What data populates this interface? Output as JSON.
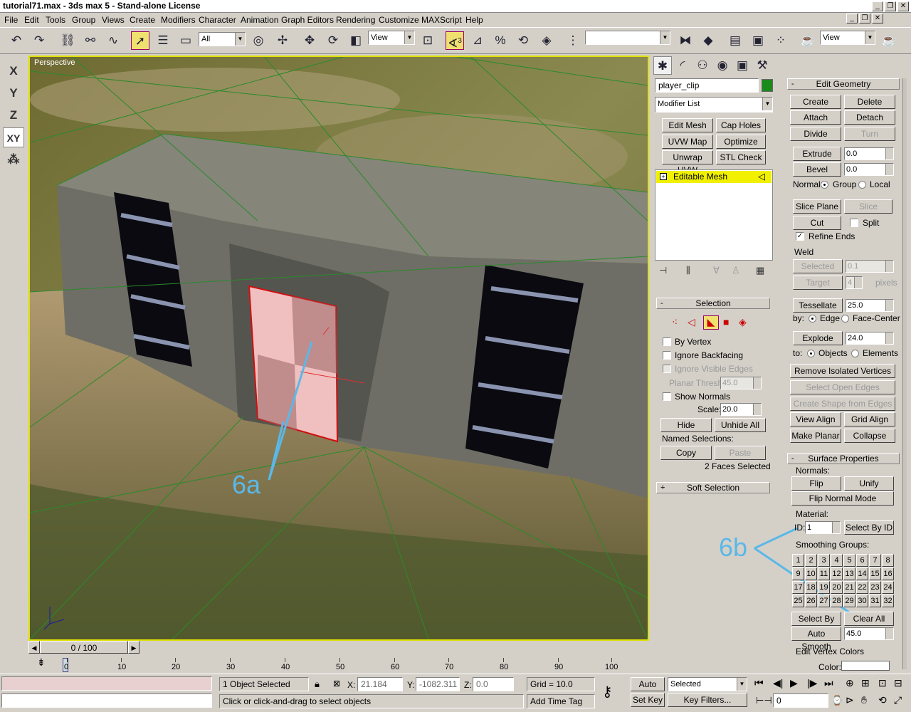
{
  "window": {
    "title": "tutorial71.max - 3ds max 5 - Stand-alone License",
    "min": "_",
    "restore": "❐",
    "close": "✕"
  },
  "menu": [
    "File",
    "Edit",
    "Tools",
    "Group",
    "Views",
    "Create",
    "Modifiers",
    "Character",
    "Animation",
    "Graph Editors",
    "Rendering",
    "Customize",
    "MAXScript",
    "Help"
  ],
  "toolbar": {
    "selection_filter": "All",
    "ref_coord": "View",
    "named_set": "",
    "view_dropdown": "View",
    "angle_snap_num": "3"
  },
  "axis_buttons": [
    "X",
    "Y",
    "Z",
    "XY"
  ],
  "viewport": {
    "label": "Perspective",
    "annotation_a": "6a",
    "annotation_b": "6b"
  },
  "cmdpanel": {
    "object_name": "player_clip",
    "object_color": "#1a8a1a",
    "modifier_list": "Modifier List",
    "mod_buttons": [
      "Edit Mesh",
      "Cap Holes",
      "UVW Map",
      "Optimize",
      "Unwrap UVW",
      "STL Check"
    ],
    "stack_item": "Editable Mesh",
    "selection": {
      "title": "Selection",
      "by_vertex": "By Vertex",
      "ignore_backfacing": "Ignore Backfacing",
      "ignore_visible_edges": "Ignore Visible Edges",
      "planar_thresh_label": "Planar Thresh:",
      "planar_thresh": "45.0",
      "show_normals": "Show Normals",
      "scale_label": "Scale:",
      "scale": "20.0",
      "hide": "Hide",
      "unhide_all": "Unhide All",
      "named_sel": "Named Selections:",
      "copy": "Copy",
      "paste": "Paste",
      "status": "2 Faces Selected"
    },
    "soft_selection": "Soft Selection"
  },
  "edit_geometry": {
    "title": "Edit Geometry",
    "create": "Create",
    "delete": "Delete",
    "attach": "Attach",
    "detach": "Detach",
    "divide": "Divide",
    "turn": "Turn",
    "extrude": "Extrude",
    "extrude_val": "0.0",
    "bevel": "Bevel",
    "bevel_val": "0.0",
    "normal_label": "Normal:",
    "group": "Group",
    "local": "Local",
    "slice_plane": "Slice Plane",
    "slice": "Slice",
    "cut": "Cut",
    "split": "Split",
    "refine_ends": "Refine Ends",
    "weld": "Weld",
    "selected": "Selected",
    "selected_val": "0.1",
    "target": "Target",
    "target_val": "4",
    "pixels": "pixels",
    "tessellate": "Tessellate",
    "tessellate_val": "25.0",
    "by": "by:",
    "edge": "Edge",
    "face_center": "Face-Center",
    "explode": "Explode",
    "explode_val": "24.0",
    "to": "to:",
    "objects": "Objects",
    "elements": "Elements",
    "remove_isolated": "Remove Isolated Vertices",
    "select_open_edges": "Select Open Edges",
    "create_shape": "Create Shape from Edges",
    "view_align": "View Align",
    "grid_align": "Grid Align",
    "make_planar": "Make Planar",
    "collapse": "Collapse"
  },
  "surface": {
    "title": "Surface Properties",
    "normals": "Normals:",
    "flip": "Flip",
    "unify": "Unify",
    "flip_normal_mode": "Flip Normal Mode",
    "material": "Material:",
    "id_label": "ID:",
    "id_val": "1",
    "select_by_id": "Select By ID",
    "smoothing_groups": "Smoothing Groups:",
    "sg": [
      "1",
      "2",
      "3",
      "4",
      "5",
      "6",
      "7",
      "8",
      "9",
      "10",
      "11",
      "12",
      "13",
      "14",
      "15",
      "16",
      "17",
      "18",
      "19",
      "20",
      "21",
      "22",
      "23",
      "24",
      "25",
      "26",
      "27",
      "28",
      "29",
      "30",
      "31",
      "32"
    ],
    "select_by_sg": "Select By SG",
    "clear_all": "Clear All",
    "auto_smooth": "Auto Smooth",
    "auto_smooth_val": "45.0",
    "edit_vertex_colors": "Edit Vertex Colors",
    "color": "Color:"
  },
  "timeline": {
    "frame": "0 / 100",
    "ticks": [
      "0",
      "10",
      "20",
      "30",
      "40",
      "50",
      "60",
      "70",
      "80",
      "90",
      "100"
    ]
  },
  "status": {
    "selected_count": "1 Object Selected",
    "prompt": "Click or click-and-drag to select objects",
    "x_label": "X:",
    "x_val": "21.184",
    "y_label": "Y:",
    "y_val": "-1082.311",
    "z_label": "Z:",
    "z_val": "0.0",
    "grid": "Grid = 10.0",
    "add_time_tag": "Add Time Tag",
    "auto_key": "Auto Key",
    "set_key": "Set Key",
    "key_mode": "Selected",
    "key_filters": "Key Filters...",
    "frame_field": "0"
  }
}
